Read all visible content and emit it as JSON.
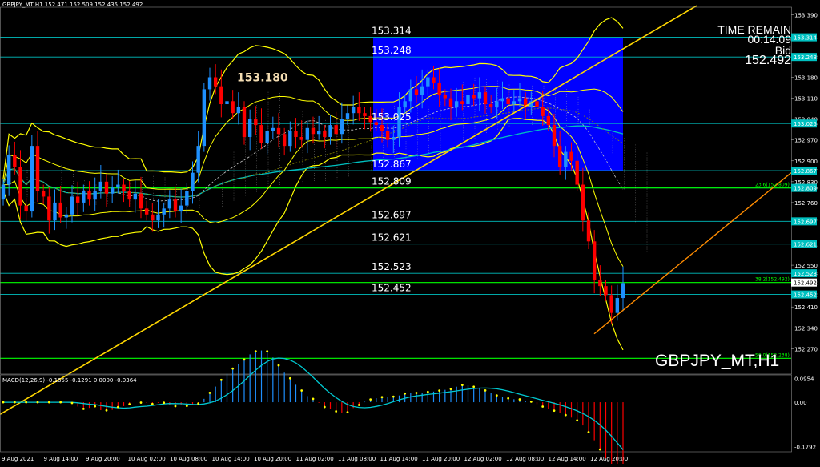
{
  "header": {
    "text": "GBPJPY_MT,H1  152.471 152.509 152.435 152.492"
  },
  "info": {
    "time_remain_label": "TIME REMAIN",
    "time_remain": "00:14:09",
    "bid_label": "Bid",
    "bid": "152.492"
  },
  "symbol_label": "GBPJPY_MT,H1",
  "colors": {
    "background": "#000000",
    "bull": "#1e90ff",
    "bear": "#ff0000",
    "bands": "#ffff00",
    "levels": "#00c0c0",
    "fib": "#00ff00",
    "rect": "#0000ff",
    "ma": "#00bfbf",
    "trend": "#ffd700",
    "channel": "#ff8c00"
  },
  "chart_data": {
    "type": "candlestick",
    "symbol": "GBPJPY_MT",
    "timeframe": "H1",
    "ohlc_header": {
      "open": 152.471,
      "high": 152.509,
      "low": 152.435,
      "close": 152.492
    },
    "y_ticks": [
      153.39,
      153.314,
      153.248,
      153.18,
      153.11,
      153.04,
      153.025,
      152.97,
      152.9,
      152.867,
      152.83,
      152.809,
      152.76,
      152.697,
      152.621,
      152.55,
      152.523,
      152.492,
      152.452,
      152.41,
      152.34,
      152.27
    ],
    "ylim": [
      152.185,
      153.415
    ],
    "x_ticks": [
      "9 Aug 2021",
      "9 Aug 14:00",
      "9 Aug 20:00",
      "10 Aug 02:00",
      "10 Aug 08:00",
      "10 Aug 14:00",
      "10 Aug 20:00",
      "11 Aug 02:00",
      "11 Aug 08:00",
      "11 Aug 14:00",
      "11 Aug 20:00",
      "12 Aug 02:00",
      "12 Aug 08:00",
      "12 Aug 14:00",
      "12 Aug 20:00"
    ],
    "levels": [
      {
        "value": 153.314,
        "label": "153.314"
      },
      {
        "value": 153.248,
        "label": "153.248"
      },
      {
        "value": 153.025,
        "label": "153.025"
      },
      {
        "value": 152.867,
        "label": "152.867"
      },
      {
        "value": 152.809,
        "label": "152.809"
      },
      {
        "value": 152.697,
        "label": "152.697"
      },
      {
        "value": 152.621,
        "label": "152.621"
      },
      {
        "value": 152.523,
        "label": "152.523"
      },
      {
        "value": 152.452,
        "label": "152.452"
      }
    ],
    "annotation": {
      "text": "153.180",
      "value": 153.18
    },
    "fib_levels": [
      {
        "label": "23.6(152.809)",
        "value": 152.809
      },
      {
        "label": "38.2(152.492)",
        "value": 152.492
      },
      {
        "label": "50.0(152.238)",
        "value": 152.238
      }
    ],
    "candles_close": [
      152.82,
      152.92,
      152.88,
      152.75,
      152.73,
      152.95,
      152.8,
      152.78,
      152.7,
      152.76,
      152.71,
      152.72,
      152.78,
      152.76,
      152.8,
      152.77,
      152.8,
      152.83,
      152.79,
      152.81,
      152.82,
      152.8,
      152.77,
      152.79,
      152.74,
      152.72,
      152.7,
      152.72,
      152.74,
      152.77,
      152.73,
      152.75,
      152.8,
      152.86,
      152.95,
      153.14,
      153.18,
      153.15,
      153.09,
      153.1,
      153.06,
      153.08,
      152.98,
      153.04,
      153.02,
      152.96,
      153.0,
      153.01,
      152.99,
      152.95,
      153.0,
      152.98,
      152.97,
      153.01,
      152.99,
      153.0,
      152.98,
      153.02,
      152.99,
      153.04,
      153.06,
      153.08,
      153.06,
      153.05,
      153.03,
      153.02,
      153.0,
      152.97,
      152.98,
      153.08,
      153.1,
      153.14,
      153.12,
      153.15,
      153.18,
      153.16,
      153.12,
      153.11,
      153.08,
      153.1,
      153.09,
      153.12,
      153.11,
      153.13,
      153.09,
      153.08,
      153.1,
      153.11,
      153.09,
      153.1,
      153.11,
      153.08,
      153.1,
      153.08,
      153.05,
      153.02,
      152.95,
      152.88,
      152.93,
      152.9,
      152.82,
      152.7,
      152.63,
      152.5,
      152.48,
      152.45,
      152.39,
      152.44,
      152.49
    ]
  },
  "macd": {
    "header": "MACD(12,26,9) -0.1655 -0.1291 0.0000 -0.0364",
    "ticks": [
      0.0954,
      0.0,
      -0.1792
    ],
    "ylim": [
      -0.2,
      0.11
    ]
  }
}
